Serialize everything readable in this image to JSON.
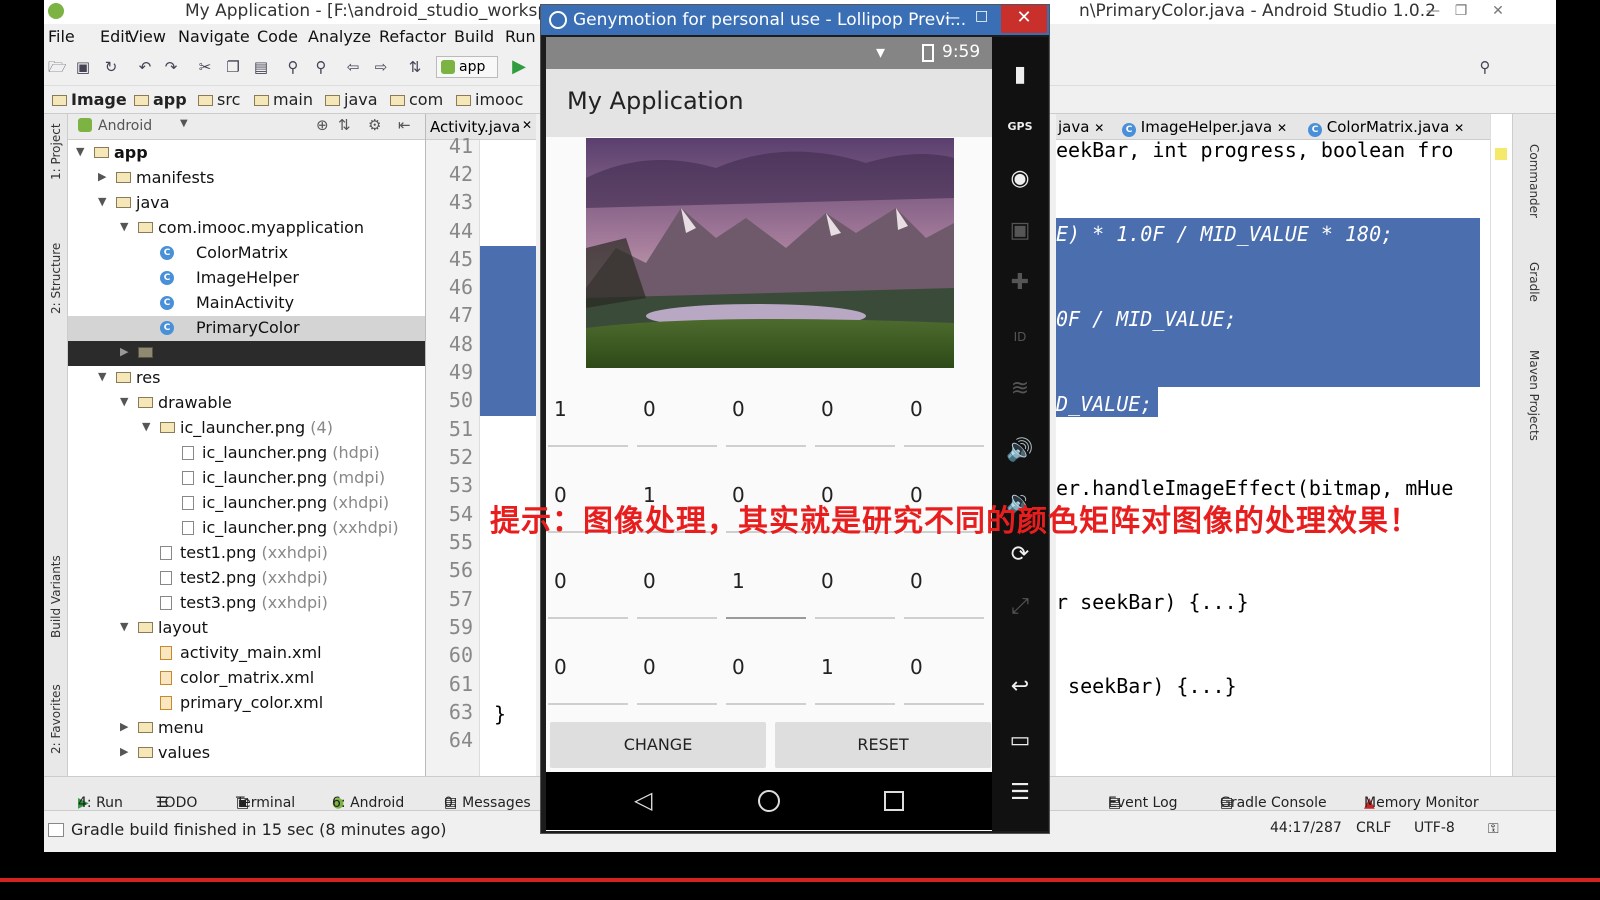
{
  "ide": {
    "title_left": "My Application - [F:\\android_studio_workspa",
    "title_right": "n\\PrimaryColor.java - Android Studio 1.0.2",
    "menu": [
      "File",
      "Edit",
      "View",
      "Navigate",
      "Code",
      "Analyze",
      "Refactor",
      "Build",
      "Run"
    ],
    "run_config": "app",
    "breadcrumbs": [
      "Image",
      "app",
      "src",
      "main",
      "java",
      "com",
      "imooc"
    ],
    "project_view": "Android",
    "tree": [
      {
        "label": "app",
        "bold": true
      },
      {
        "label": "manifests"
      },
      {
        "label": "java"
      },
      {
        "label": "com.imooc.myapplication"
      },
      {
        "label": "ColorMatrix"
      },
      {
        "label": "ImageHelper"
      },
      {
        "label": "MainActivity"
      },
      {
        "label": "PrimaryColor"
      },
      {
        "label": "res"
      },
      {
        "label": "drawable"
      },
      {
        "label": "ic_launcher.png",
        "suffix": "(4)"
      },
      {
        "label": "ic_launcher.png",
        "suffix": "(hdpi)"
      },
      {
        "label": "ic_launcher.png",
        "suffix": "(mdpi)"
      },
      {
        "label": "ic_launcher.png",
        "suffix": "(xhdpi)"
      },
      {
        "label": "ic_launcher.png",
        "suffix": "(xxhdpi)"
      },
      {
        "label": "test1.png",
        "suffix": "(xxhdpi)"
      },
      {
        "label": "test2.png",
        "suffix": "(xxhdpi)"
      },
      {
        "label": "test3.png",
        "suffix": "(xxhdpi)"
      },
      {
        "label": "layout"
      },
      {
        "label": "activity_main.xml"
      },
      {
        "label": "color_matrix.xml"
      },
      {
        "label": "primary_color.xml"
      },
      {
        "label": "menu"
      },
      {
        "label": "values"
      }
    ],
    "left_tab": "Activity.java",
    "line_numbers": [
      "41",
      "42",
      "43",
      "44",
      "45",
      "46",
      "47",
      "48",
      "49",
      "50",
      "51",
      "52",
      "53",
      "54",
      "55",
      "56",
      "57",
      "59",
      "60",
      "61",
      "63",
      "64"
    ],
    "brace_line": "}",
    "right_tabs": [
      "java",
      "ImageHelper.java",
      "ColorMatrix.java"
    ],
    "code_lines": [
      "eekBar, int progress, boolean fro",
      "E) * 1.0F / MID_VALUE * 180;",
      "0F / MID_VALUE;",
      "D_VALUE;",
      "er.handleImageEffect(bitmap, mHue",
      "r seekBar) {...}",
      " seekBar) {...}"
    ],
    "side_tabs_left": [
      "1: Project",
      "2: Structure",
      "Build Variants",
      "2: Favorites"
    ],
    "side_tabs_right": [
      "Commander",
      "Gradle",
      "Maven Projects"
    ],
    "bottom_tabs": [
      "4: Run",
      "TODO",
      "Terminal",
      "6: Android",
      "0: Messages",
      "Event Log",
      "Gradle Console",
      "Memory Monitor"
    ],
    "status_message": "Gradle build finished in 15 sec (8 minutes ago)",
    "cursor_pos": "44:17/287",
    "line_sep": "CRLF",
    "encoding": "UTF-8"
  },
  "emulator": {
    "title": "Genymotion for personal use - Lollipop Previ...",
    "time": "9:59",
    "app_title": "My Application",
    "matrix": [
      [
        "1",
        "0",
        "0",
        "0",
        "0"
      ],
      [
        "0",
        "1",
        "0",
        "0",
        "0"
      ],
      [
        "0",
        "0",
        "1",
        "0",
        "0"
      ],
      [
        "0",
        "0",
        "0",
        "1",
        "0"
      ]
    ],
    "change_label": "CHANGE",
    "reset_label": "RESET",
    "side_labels": [
      "GPS",
      "ID"
    ]
  },
  "caption": "提示：图像处理，其实就是研究不同的颜色矩阵对图像的处理效果！",
  "colors": {
    "selection": "#4b6eaf",
    "caption": "#e81e1e",
    "emu_title": "#3a6fb5"
  }
}
